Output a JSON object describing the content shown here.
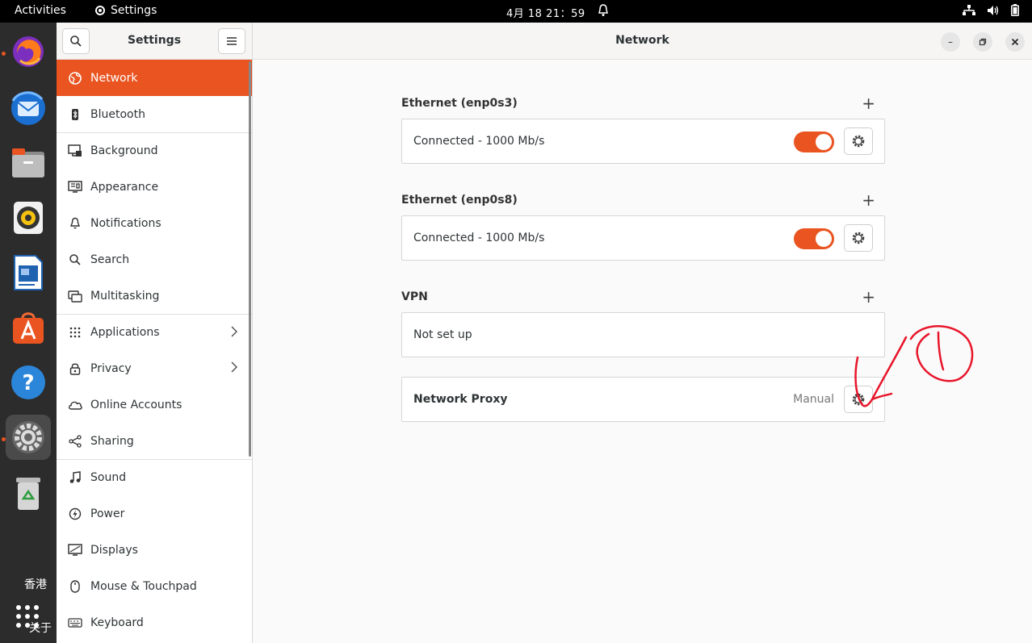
{
  "topbar": {
    "activities": "Activities",
    "app_name": "Settings",
    "clock": "4月 18  21：59"
  },
  "dock": {
    "items": [
      "firefox-icon",
      "thunderbird-icon",
      "files-icon",
      "rhythmbox-icon",
      "writer-icon",
      "software-icon",
      "help-icon",
      "settings-icon",
      "trash-icon"
    ],
    "text_1": "香港",
    "text_2": "关于"
  },
  "sidebar": {
    "title": "Settings",
    "items": [
      {
        "label": "Network",
        "icon": "network-icon"
      },
      {
        "label": "Bluetooth",
        "icon": "bluetooth-icon"
      },
      {
        "label": "Background",
        "icon": "background-icon"
      },
      {
        "label": "Appearance",
        "icon": "appearance-icon"
      },
      {
        "label": "Notifications",
        "icon": "bell-icon"
      },
      {
        "label": "Search",
        "icon": "search-icon"
      },
      {
        "label": "Multitasking",
        "icon": "multitasking-icon"
      },
      {
        "label": "Applications",
        "icon": "apps-icon"
      },
      {
        "label": "Privacy",
        "icon": "lock-icon"
      },
      {
        "label": "Online Accounts",
        "icon": "cloud-icon"
      },
      {
        "label": "Sharing",
        "icon": "share-icon"
      },
      {
        "label": "Sound",
        "icon": "music-icon"
      },
      {
        "label": "Power",
        "icon": "power-icon"
      },
      {
        "label": "Displays",
        "icon": "display-icon"
      },
      {
        "label": "Mouse & Touchpad",
        "icon": "mouse-icon"
      },
      {
        "label": "Keyboard",
        "icon": "keyboard-icon"
      }
    ]
  },
  "main": {
    "title": "Network",
    "eth1": {
      "title": "Ethernet (enp0s3)",
      "status": "Connected - 1000 Mb/s"
    },
    "eth2": {
      "title": "Ethernet (enp0s8)",
      "status": "Connected - 1000 Mb/s"
    },
    "vpn": {
      "title": "VPN",
      "status": "Not set up"
    },
    "proxy": {
      "title": "Network Proxy",
      "status": "Manual"
    }
  },
  "colors": {
    "accent": "#e95420",
    "annotation": "#e8152a"
  }
}
